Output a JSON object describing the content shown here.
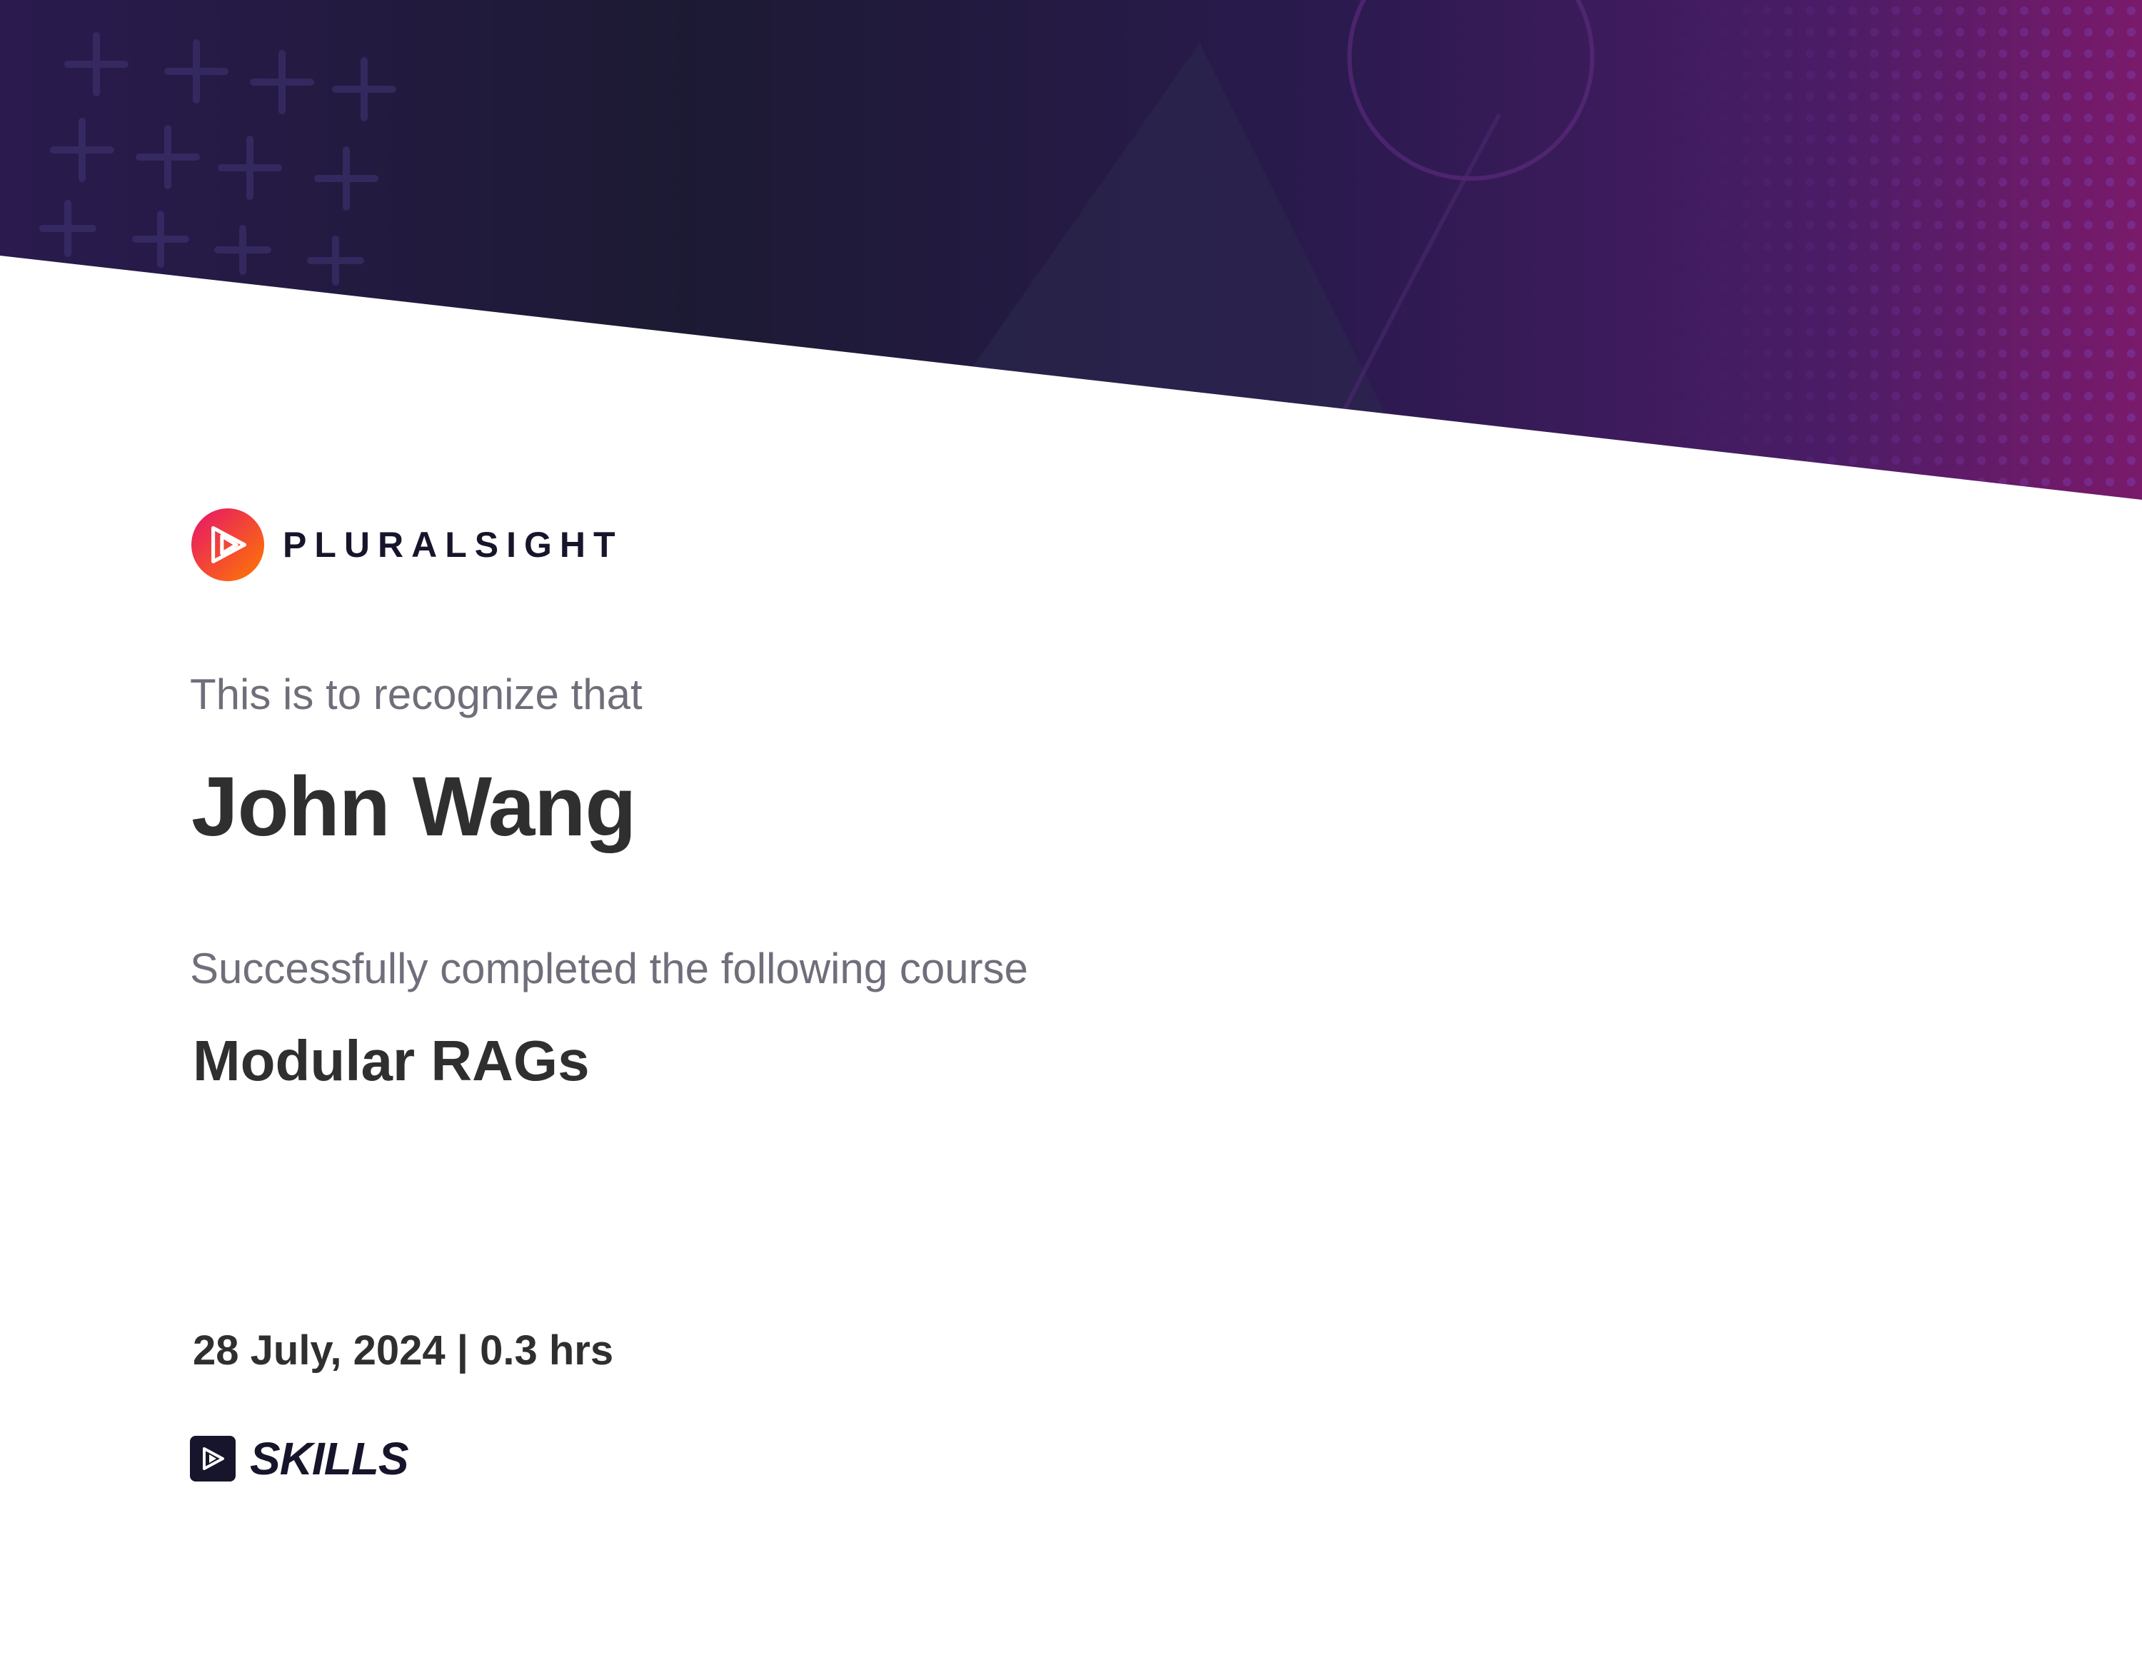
{
  "certificate": {
    "brand": {
      "name": "PLURALSIGHT",
      "logo_icon": "pluralsight-play-icon",
      "logo_gradient": [
        "#e6136b",
        "#ff7a00"
      ]
    },
    "intro": "This is to recognize that",
    "recipient": "John Wang",
    "completed_label": "Successfully completed the following course",
    "course_title": "Modular RAGs",
    "date_and_duration": "28 July, 2024 | 0.3 hrs",
    "product": {
      "icon": "skills-play-icon",
      "label": "SKILLS"
    },
    "colors": {
      "banner_dark": "#1c1a33",
      "banner_purple": "#3a1a5c",
      "banner_magenta": "#7a1a6a",
      "brand_text": "#16152b",
      "body_text": "#2f2f2f",
      "muted_text": "#6f6f7b"
    }
  }
}
